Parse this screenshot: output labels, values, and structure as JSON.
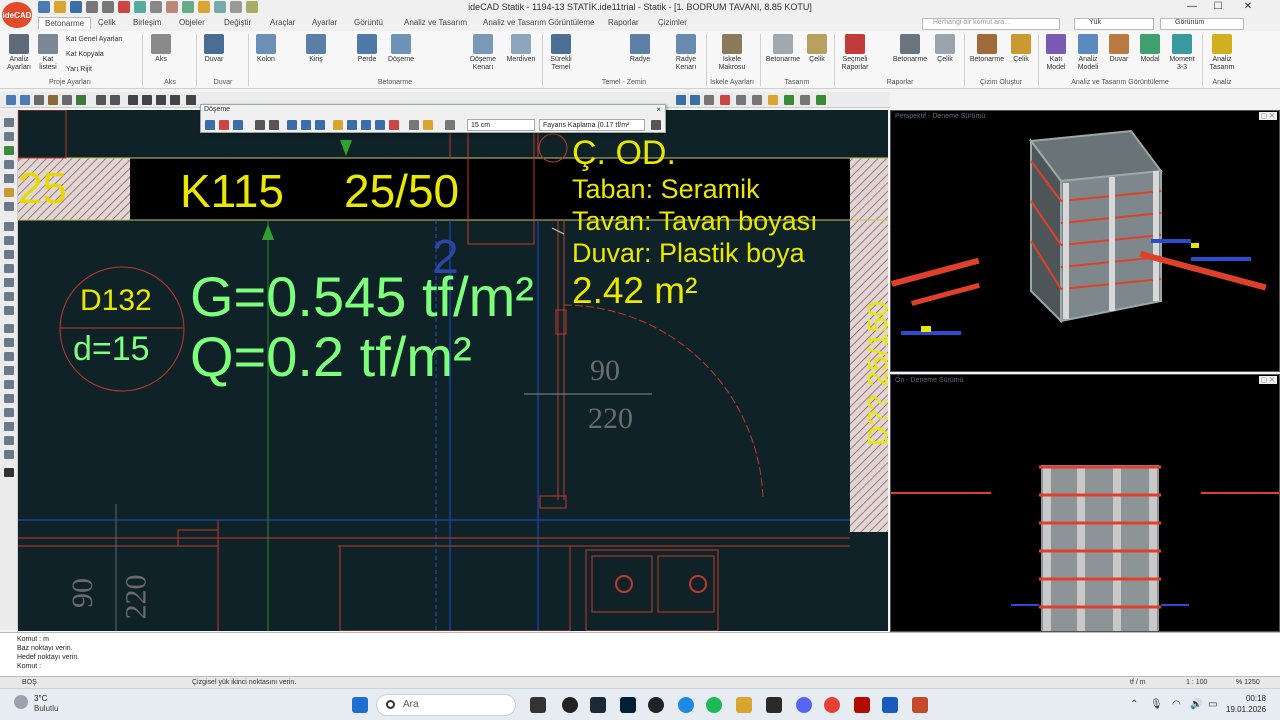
{
  "window": {
    "title": "ideCAD Statik - 1194-13 STATİK.ide11trial - Statik - [1. BODRUM TAVANI,  8.85 KOTU]",
    "logo": "ideCAD",
    "controls": [
      "—",
      "☐",
      "✕"
    ]
  },
  "tabs": [
    "Betonarme",
    "Çelik",
    "Birleşim",
    "Objeler",
    "Değiştir",
    "Araçlar",
    "Ayarlar",
    "Görüntü",
    "Analiz ve Tasarım",
    "Analiz ve Tasarım Görüntüleme",
    "Raporlar",
    "Çizimler"
  ],
  "active_tab": "Betonarme",
  "command_search": {
    "placeholder": "Herhangi bir komut ara..."
  },
  "level_combo": "Yük",
  "view_combo": "Görünüm",
  "ribbon": {
    "buttons": [
      {
        "label": "Analiz Ayarları",
        "color": "#5f6b78"
      },
      {
        "label": "Kat listesi",
        "color": "#7a8794"
      },
      {
        "label": "Aks",
        "color": "#8a8a8a"
      },
      {
        "label": "Duvar",
        "color": "#4a6d92"
      },
      {
        "label": "Kolon",
        "color": "#6b8fb5"
      },
      {
        "label": "Kiriş",
        "color": "#5b7ea4"
      },
      {
        "label": "Perde",
        "color": "#4f79a6"
      },
      {
        "label": "Döşeme",
        "color": "#6f93b8"
      },
      {
        "label": "Döşeme Kenarı",
        "color": "#7a98b8"
      },
      {
        "label": "Merdiven",
        "color": "#8ea5be"
      },
      {
        "label": "Sürekli Temel",
        "color": "#4d6f94"
      },
      {
        "label": "Radye",
        "color": "#5c7fa5"
      },
      {
        "label": "Radye Kenarı",
        "color": "#6a8bb0"
      },
      {
        "label": "İskele Makrosu",
        "color": "#8a7a5a"
      },
      {
        "label": "Betonarme",
        "color": "#a0a8b0"
      },
      {
        "label": "Çelik",
        "color": "#b8a060"
      },
      {
        "label": "Seçmeli Raporlar",
        "color": "#c23a3a"
      },
      {
        "label": "Betonarme",
        "color": "#6a7580"
      },
      {
        "label": "Çelik",
        "color": "#9aa4ae"
      },
      {
        "label": "Betonarme",
        "color": "#a06a3a"
      },
      {
        "label": "Çelik",
        "color": "#c89a30"
      },
      {
        "label": "Katı Model",
        "color": "#7a5ab0"
      },
      {
        "label": "Analiz Modeli",
        "color": "#5a8ac0"
      },
      {
        "label": "Duvar",
        "color": "#b87a40"
      },
      {
        "label": "Modal",
        "color": "#40a070"
      },
      {
        "label": "Moment 3-3",
        "color": "#3a9aa0"
      },
      {
        "label": "Analiz Tasarım",
        "color": "#d0b020"
      }
    ],
    "small_commands": [
      "Kat Genel Ayarları",
      "Kat Kopyala",
      "Yarı Rijit"
    ],
    "groups": [
      "Proje Ayarları",
      "Aks",
      "Duvar",
      "Betonarme",
      "Temel - Zemin",
      "İskele Ayarları",
      "Tasarım",
      "Raporlar",
      "Çizim Oluştur",
      "Analiz ve Tasarım Görüntüleme",
      "Analiz"
    ]
  },
  "float_toolbar": {
    "title": "Döşeme",
    "close": "×",
    "thickness": "15 cm",
    "load": "Fayans Kaplama (0.17 tf/m²"
  },
  "cad": {
    "beam_left_label": "25",
    "beam_label": "K115",
    "beam_size": "25/50",
    "slab_id": "D132",
    "slab_thickness": "d=15",
    "dead_load": "G=0.545 tf/m²",
    "live_load": "Q=0.2 tf/m²",
    "room_name": "Ç. OD.",
    "room_floor": "Taban: Seramik",
    "room_ceiling": "Tavan: Tavan boyası",
    "room_wall": "Duvar: Plastik boya",
    "room_area": "2.42 m²",
    "door_width": "90",
    "door_height": "220",
    "window_width": "90",
    "window_height": "220",
    "slab_num_2": "2",
    "right_beam_label": "D??  25/150"
  },
  "panes": {
    "perspective": "Perspektif - Deneme Sürümü",
    "front": "Ön - Deneme Sürümü"
  },
  "command_log": [
    "Komut : m",
    "Baz noktayı verin.",
    "Hedef noktayı verin.",
    "Komut :"
  ],
  "status": {
    "mode": "BOŞ",
    "message": "Çizgisel yük ikinci noktasını verin.",
    "unit": "tf / m",
    "scale": "1 : 100",
    "zoom": "% 1250"
  },
  "taskbar": {
    "weather_temp": "3°C",
    "weather_text": "Bulutlu",
    "search_placeholder": "Ara",
    "time": "00:18",
    "date": "19.01.2026"
  }
}
